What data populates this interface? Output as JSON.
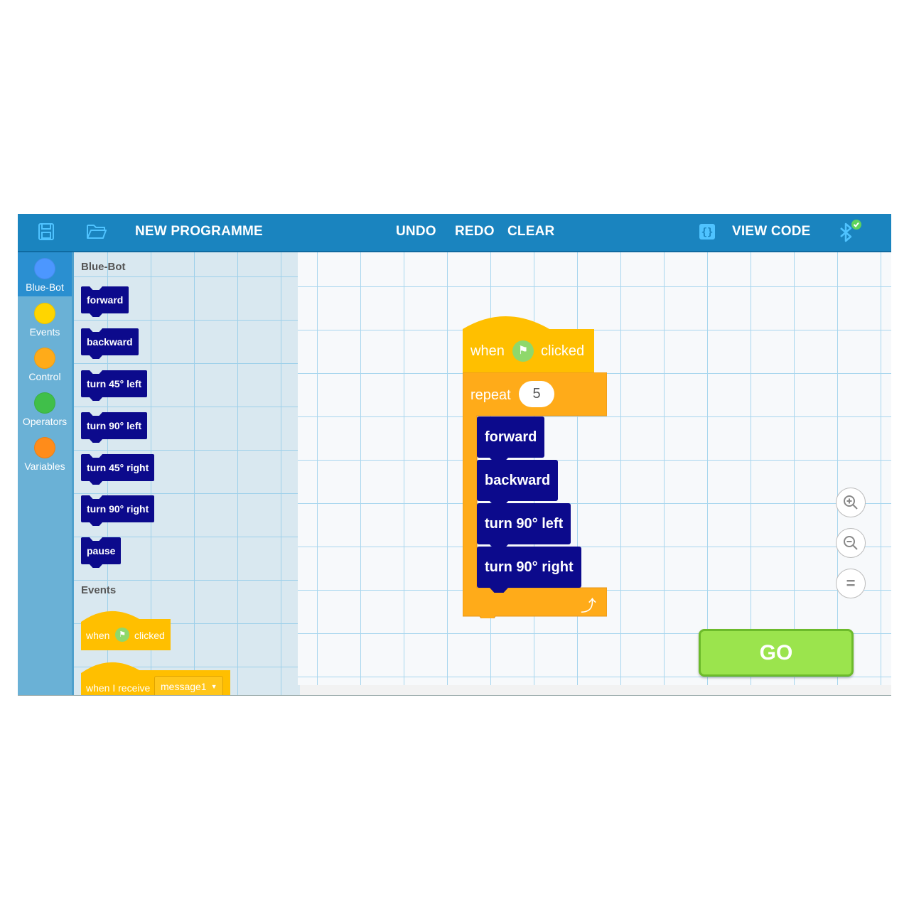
{
  "toolbar": {
    "programme_title": "NEW PROGRAMME",
    "undo": "UNDO",
    "redo": "REDO",
    "clear": "CLEAR",
    "view_code": "VIEW CODE",
    "icons": [
      "save-icon",
      "folder-open-icon",
      "code-braces-icon",
      "bluetooth-connected-icon"
    ]
  },
  "categories": [
    {
      "label": "Blue-Bot",
      "color": "#4c97ff",
      "active": true
    },
    {
      "label": "Events",
      "color": "#ffd500"
    },
    {
      "label": "Control",
      "color": "#ffab19"
    },
    {
      "label": "Operators",
      "color": "#40bf4a"
    },
    {
      "label": "Variables",
      "color": "#ff8c1a"
    }
  ],
  "palette": {
    "bluebot_heading": "Blue-Bot",
    "motion_blocks": [
      "forward",
      "backward",
      "turn 45° left",
      "turn 90° left",
      "turn 45° right",
      "turn 90° right",
      "pause"
    ],
    "events_heading": "Events",
    "when_label": "when",
    "clicked_label": "clicked",
    "when_receive_label": "when I receive",
    "message_value": "message1"
  },
  "script": {
    "hat_when": "when",
    "hat_clicked": "clicked",
    "repeat_label": "repeat",
    "repeat_count": "5",
    "body_blocks": [
      "forward",
      "backward",
      "turn 90° left",
      "turn 90° right"
    ]
  },
  "zoom": {
    "in": "+",
    "out": "−",
    "reset": "="
  },
  "go_label": "GO",
  "colors": {
    "topbar": "#1a84bf",
    "motion_block": "#0c0a8c",
    "events_block": "#ffbf00",
    "control_block": "#ffab19",
    "go_button": "#9be44d"
  }
}
